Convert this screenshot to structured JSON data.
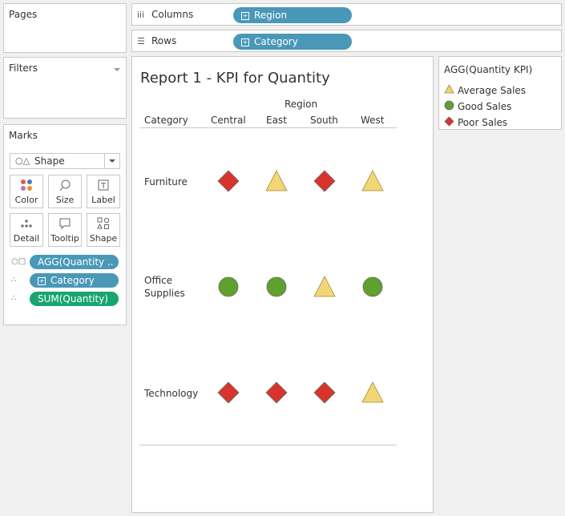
{
  "panels": {
    "pages": "Pages",
    "filters": "Filters",
    "marks": "Marks"
  },
  "marks_card": {
    "mark_type": "Shape",
    "buttons": [
      "Color",
      "Size",
      "Label",
      "Detail",
      "Tooltip",
      "Shape"
    ],
    "pills": [
      {
        "label": "AGG(Quantity ..",
        "color": "#4a98b8",
        "icon": "shape-icon"
      },
      {
        "label": "Category",
        "color": "#4a98b8",
        "icon": "detail-icon",
        "plus": true
      },
      {
        "label": "SUM(Quantity)",
        "color": "#19a56f",
        "icon": "detail-icon"
      }
    ]
  },
  "shelves": {
    "columns": {
      "label": "Columns",
      "pill": "Region"
    },
    "rows": {
      "label": "Rows",
      "pill": "Category"
    }
  },
  "view": {
    "title": "Report 1 - KPI for Quantity",
    "column_header": "Region",
    "row_header": "Category",
    "regions": [
      "Central",
      "East",
      "South",
      "West"
    ],
    "categories": [
      {
        "label": "Furniture",
        "kpi": [
          "Poor Sales",
          "Average Sales",
          "Poor Sales",
          "Average Sales"
        ]
      },
      {
        "label": "Office\nSupplies",
        "kpi": [
          "Good Sales",
          "Good Sales",
          "Average Sales",
          "Good Sales"
        ]
      },
      {
        "label": "Technology",
        "kpi": [
          "Poor Sales",
          "Poor Sales",
          "Poor Sales",
          "Average Sales"
        ]
      }
    ]
  },
  "legend": {
    "title": "AGG(Quantity KPI)",
    "items": [
      {
        "label": "Average Sales",
        "shape": "triangle",
        "color": "#f2d675"
      },
      {
        "label": "Good Sales",
        "shape": "circle",
        "color": "#5fa02e"
      },
      {
        "label": "Poor Sales",
        "shape": "diamond",
        "color": "#d9342b"
      }
    ]
  }
}
